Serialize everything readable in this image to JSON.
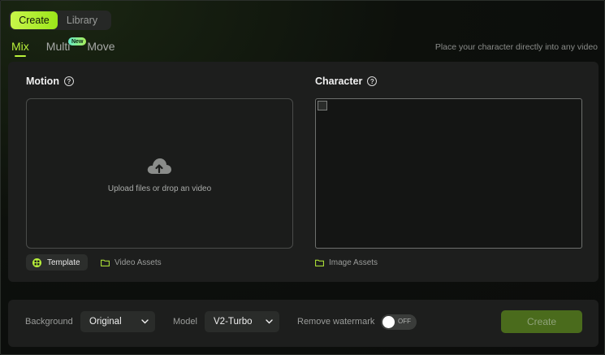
{
  "top_tabs": {
    "create": "Create",
    "library": "Library"
  },
  "modes": {
    "mix": "Mix",
    "multi": "Multi",
    "new_badge": "New",
    "move": "Move"
  },
  "tagline": "Place your character directly into any video",
  "motion": {
    "title": "Motion",
    "help": "?",
    "upload_text": "Upload files or drop an video",
    "template_label": "Template",
    "video_assets_label": "Video Assets"
  },
  "character": {
    "title": "Character",
    "help": "?",
    "image_assets_label": "Image Assets"
  },
  "bottom": {
    "background_label": "Background",
    "background_value": "Original",
    "model_label": "Model",
    "model_value": "V2-Turbo",
    "watermark_label": "Remove watermark",
    "watermark_state": "OFF",
    "create_label": "Create"
  },
  "colors": {
    "accent": "#b9f23a",
    "create_disabled": "#4a6b1c"
  }
}
